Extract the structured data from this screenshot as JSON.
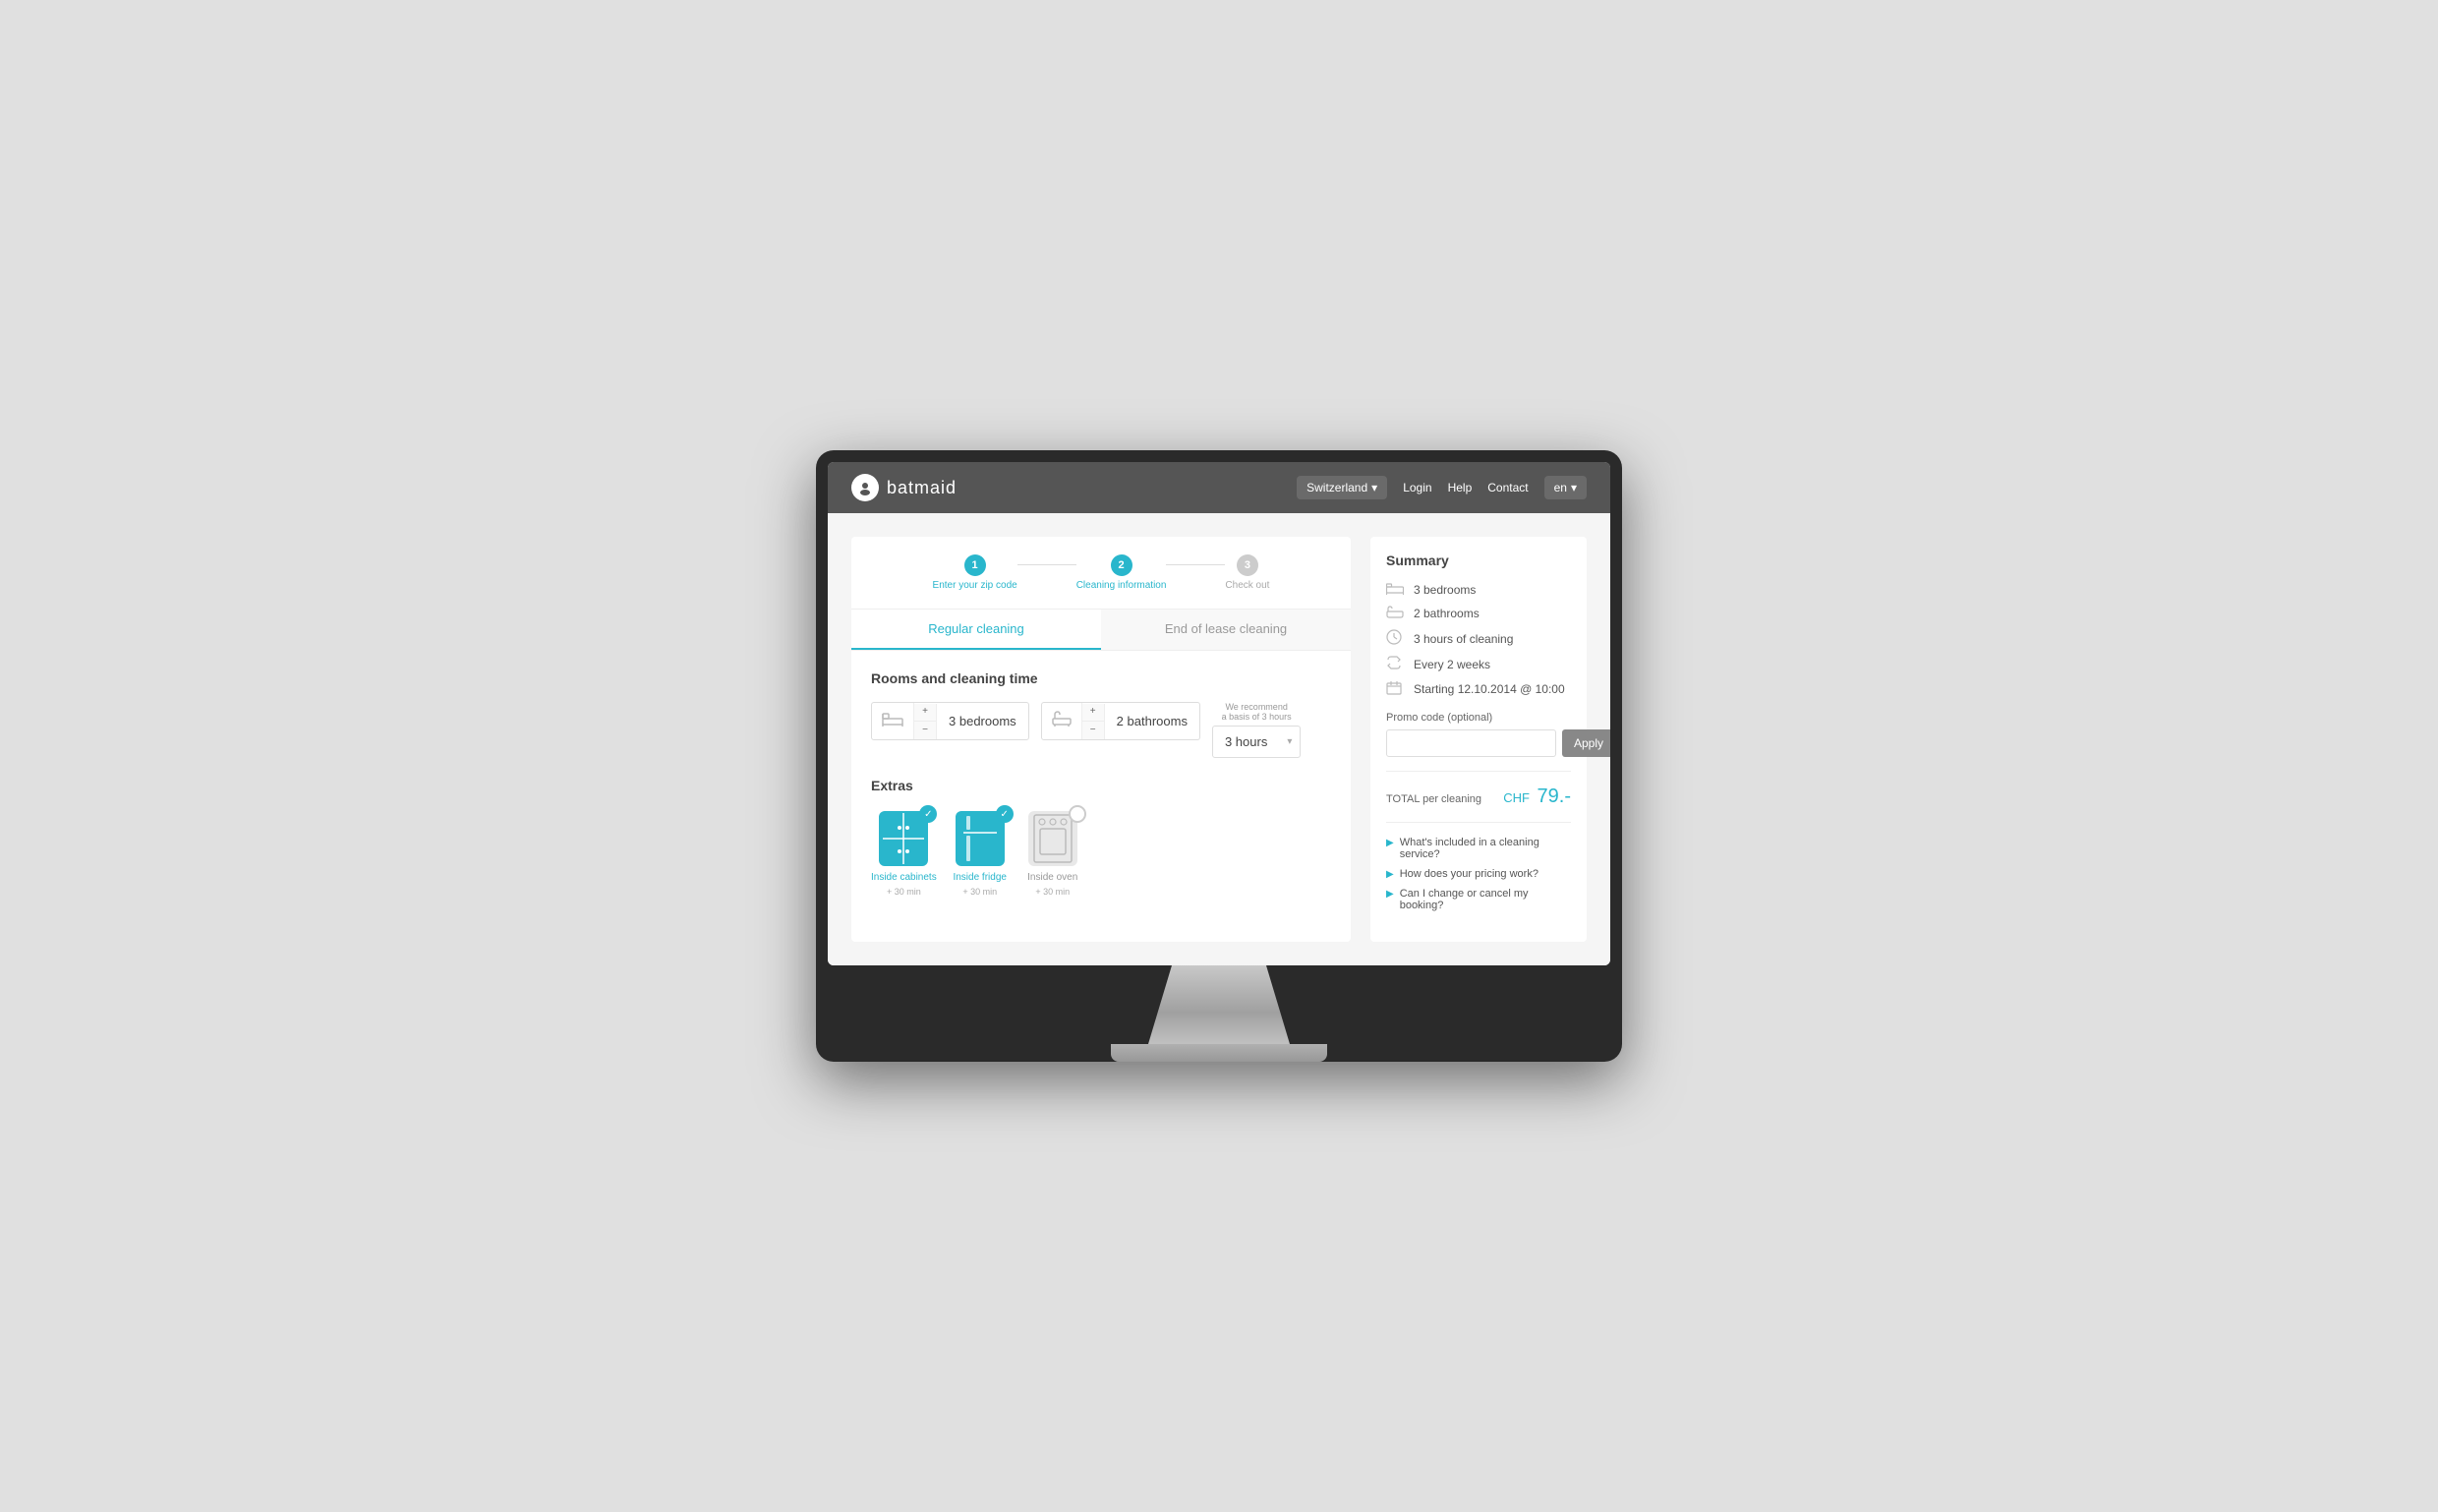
{
  "monitor": {
    "screen_bg": "#f0f0f0"
  },
  "header": {
    "logo_text": "batmaid",
    "country": "Switzerland",
    "nav_links": [
      "Login",
      "Help",
      "Contact"
    ],
    "lang": "en"
  },
  "steps": [
    {
      "number": "1",
      "label": "Enter your zip code",
      "active": true
    },
    {
      "number": "2",
      "label": "Cleaning information",
      "active": true
    },
    {
      "number": "3",
      "label": "Check out",
      "active": false
    }
  ],
  "tabs": [
    {
      "label": "Regular cleaning",
      "active": true
    },
    {
      "label": "End of lease cleaning",
      "active": false
    }
  ],
  "rooms": {
    "section_title": "Rooms and cleaning time",
    "recommend_text": "We recommend a basis of 3 hours",
    "bedrooms": {
      "count": 3,
      "label": "bedrooms"
    },
    "bathrooms": {
      "count": 2,
      "label": "bathrooms"
    },
    "hours": {
      "value": "3 hours"
    }
  },
  "extras": {
    "title": "Extras",
    "items": [
      {
        "label": "Inside cabinets",
        "time": "+ 30 min",
        "selected": true
      },
      {
        "label": "Inside fridge",
        "time": "+ 30 min",
        "selected": true
      },
      {
        "label": "Inside oven",
        "time": "+ 30 min",
        "selected": false
      }
    ]
  },
  "summary": {
    "title": "Summary",
    "items": [
      {
        "icon": "bed",
        "text": "3  bedrooms"
      },
      {
        "icon": "bath",
        "text": "2  bathrooms"
      },
      {
        "icon": "clock",
        "text": "3 hours of cleaning"
      },
      {
        "icon": "repeat",
        "text": "Every 2 weeks"
      },
      {
        "icon": "calendar",
        "text": "Starting 12.10.2014 @ 10:00"
      }
    ],
    "promo_label": "Promo code (optional)",
    "promo_placeholder": "",
    "apply_label": "Apply",
    "total_label": "TOTAL per cleaning",
    "currency": "CHF",
    "price": "79.-",
    "faq": [
      {
        "text": "What's included in a cleaning service?"
      },
      {
        "text": "How does your pricing work?"
      },
      {
        "text": "Can I change or cancel my booking?"
      }
    ]
  }
}
